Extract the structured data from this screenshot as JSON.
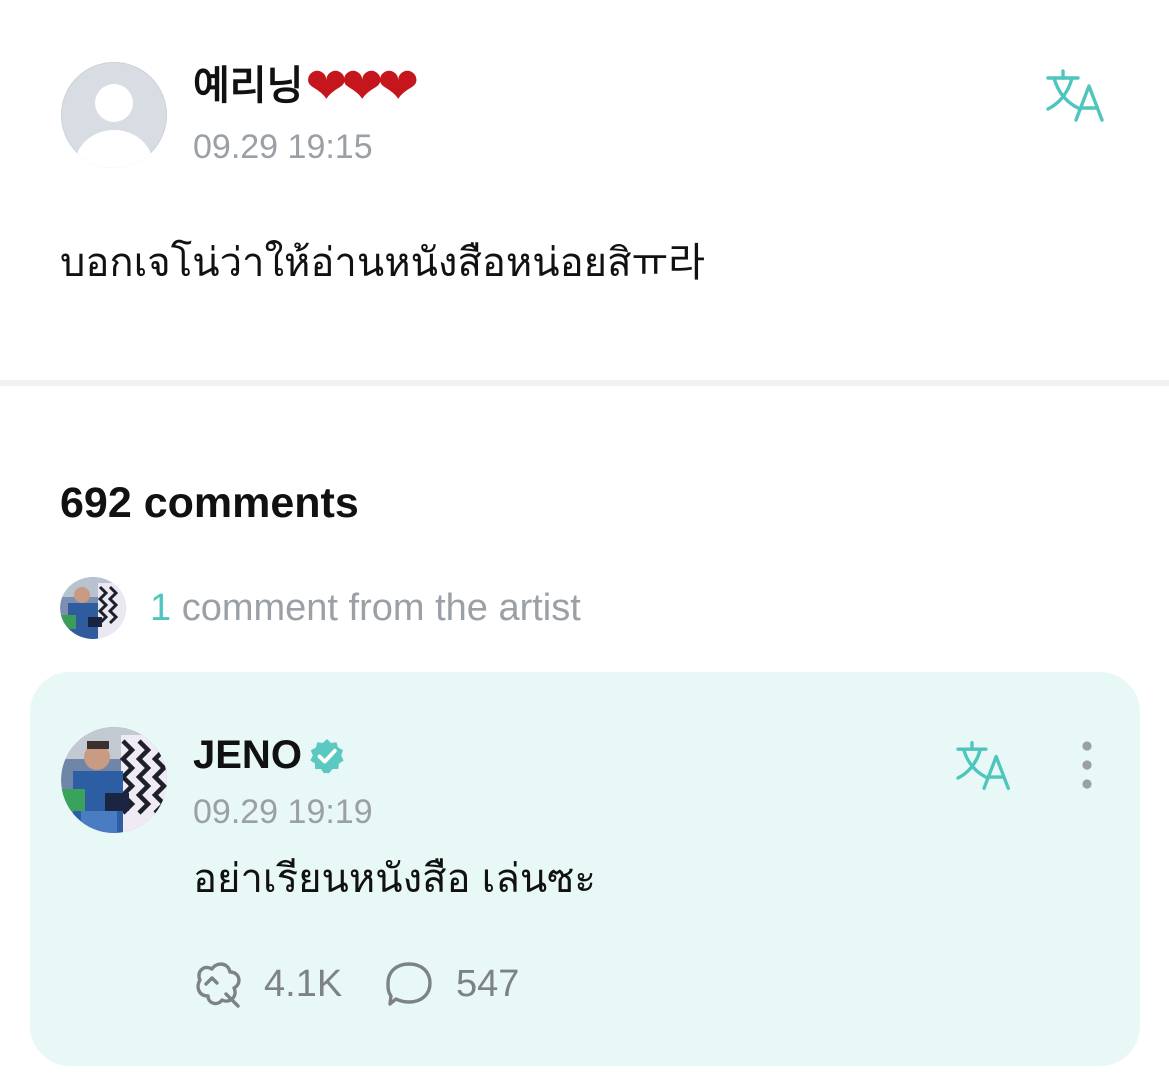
{
  "post": {
    "author_name": "예리닝",
    "author_hearts": "❤❤❤",
    "timestamp": "09.29 19:15",
    "body": "บอกเจโน่ว่าให้อ่านหนังสือหน่อยสิㅠ라",
    "translate_icon": "translate-icon"
  },
  "comments": {
    "count_label": "692 comments",
    "artist_summary": {
      "count": "1",
      "label": " comment from the artist"
    }
  },
  "artist_comment": {
    "author_name": "JENO",
    "verified_icon": "verified-check-icon",
    "timestamp": "09.29 19:19",
    "text": "อย่าเรียนหนังสือ เล่นซะ",
    "likes": "4.1K",
    "replies": "547",
    "translate_icon": "translate-icon",
    "more_icon": "more-vertical-icon"
  },
  "colors": {
    "accent": "#4fc6bd",
    "card_background": "#e8f8f6",
    "muted_text": "#9aa0a6",
    "heart": "#c4161c"
  }
}
